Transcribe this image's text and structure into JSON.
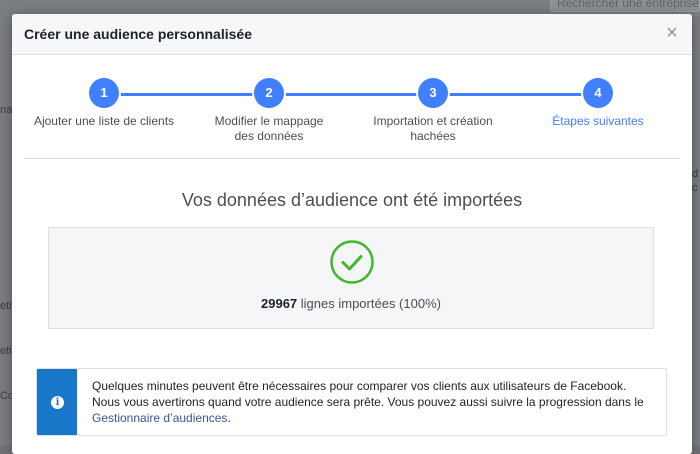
{
  "background": {
    "search_text": "Rechercher une entreprise",
    "left_fragments": [
      "na",
      "eti",
      "eti",
      "Co"
    ],
    "right_fragments": [
      "d",
      "c"
    ]
  },
  "modal": {
    "title": "Créer une audience personnalisée",
    "close_label": "×"
  },
  "stepper": {
    "steps": [
      {
        "number": "1",
        "label": "Ajouter une liste de clients",
        "state": "completed"
      },
      {
        "number": "2",
        "label": "Modifier le mappage des données",
        "state": "completed"
      },
      {
        "number": "3",
        "label": "Importation et création hachées",
        "state": "completed"
      },
      {
        "number": "4",
        "label": "Étapes suivantes",
        "state": "active"
      }
    ]
  },
  "result": {
    "heading": "Vos données d’audience ont été importées",
    "count": "29967",
    "suffix": " lignes importées (100%)"
  },
  "info": {
    "text_main": "Quelques minutes peuvent être nécessaires pour comparer vos clients aux utilisateurs de Facebook. Nous vous avertirons quand votre audience sera prête. Vous pouvez aussi suivre la progression dans le ",
    "link": "Gestionnaire d’audiences",
    "text_end": "."
  },
  "colors": {
    "accent": "#4080ff",
    "success": "#42b72a",
    "info": "#1877c9"
  },
  "icons": {
    "close": "close-icon",
    "check": "check-circle-icon",
    "info": "info-icon"
  }
}
